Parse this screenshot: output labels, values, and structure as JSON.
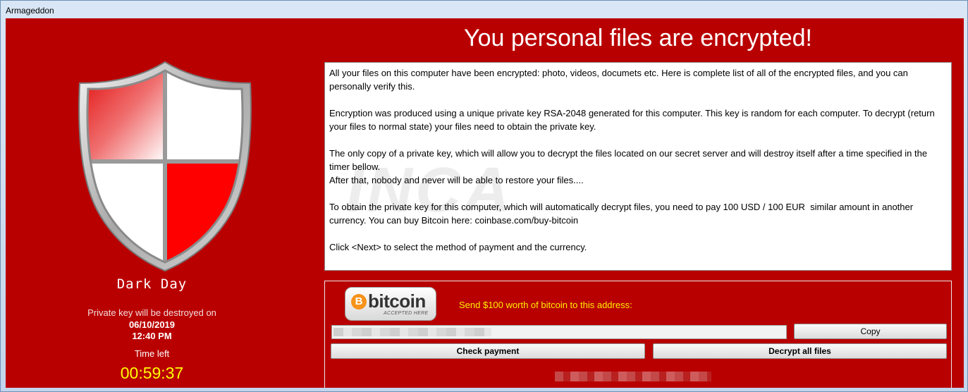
{
  "window": {
    "title": "Armageddon"
  },
  "left_panel": {
    "shield_icon": "red-white-shield-icon",
    "brand_name": "Dark Day",
    "destroy_label": "Private key will be destroyed on",
    "destroy_date": "06/10/2019",
    "destroy_time": "12:40 PM",
    "time_left_label": "Time left",
    "timer": "00:59:37"
  },
  "main": {
    "headline": "You personal files are encrypted!",
    "message": "All your files on this computer have been encrypted: photo, videos, documets etc. Here is complete list of all of the encrypted files, and you can personally verify this.\n\nEncryption was produced using a unique private key RSA-2048 generated for this computer. This key is random for each computer. To decrypt (return your files to normal state) your files need to obtain the private key.\n\nThe only copy of a private key, which will allow you to decrypt the files located on our secret server and will destroy itself after a time specified in the timer bellow.\nAfter that, nobody and never will be able to restore your files....\n\nTo obtain the private key for this computer, which will automatically decrypt files, you need to pay 100 USD / 100 EUR  similar amount in another currency. You can buy Bitcoin here: coinbase.com/buy-bitcoin\n\nClick <Next> to select the method of payment and the currency.",
    "watermark": "INCA"
  },
  "payment": {
    "bitcoin_logo": {
      "symbol": "B",
      "word": "bitcoin",
      "subtitle": "ACCEPTED HERE"
    },
    "send_label": "Send $100 worth of bitcoin to this address:",
    "copy_label": "Copy",
    "check_label": "Check payment",
    "decrypt_label": "Decrypt all files"
  },
  "colors": {
    "background_red": "#b90000",
    "timer_yellow": "#ffff00",
    "send_label_yellow": "#ffee00",
    "bitcoin_orange": "#f7931a"
  }
}
